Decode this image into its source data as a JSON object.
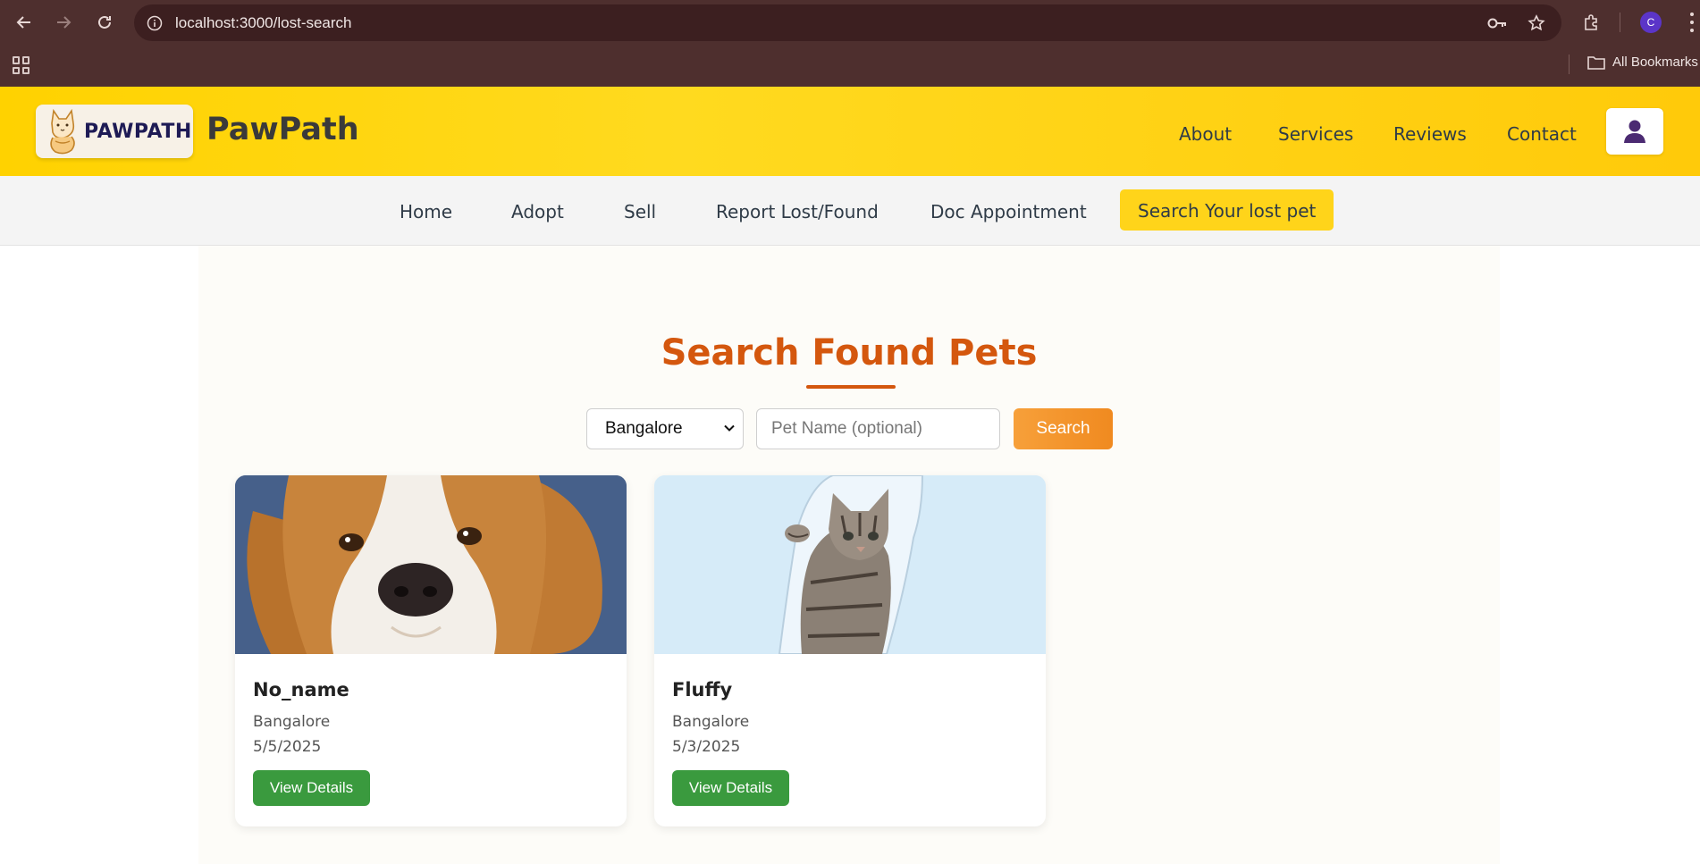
{
  "browser": {
    "url": "localhost:3000/lost-search",
    "avatar_letter": "C",
    "all_bookmarks": "All Bookmarks"
  },
  "header": {
    "logo_text": "PAWPATH",
    "brand": "PawPath",
    "nav": [
      "About",
      "Services",
      "Reviews",
      "Contact"
    ]
  },
  "subnav": {
    "items": [
      "Home",
      "Adopt",
      "Sell",
      "Report Lost/Found",
      "Doc Appointment"
    ],
    "active": "Search Your lost pet"
  },
  "main": {
    "title": "Search Found Pets",
    "city_selected": "Bangalore",
    "name_placeholder": "Pet Name (optional)",
    "search_label": "Search",
    "cards": [
      {
        "name": "No_name",
        "city": "Bangalore",
        "date": "5/5/2025",
        "button": "View Details",
        "image": "dog-photo"
      },
      {
        "name": "Fluffy",
        "city": "Bangalore",
        "date": "5/3/2025",
        "button": "View Details",
        "image": "cat-photo"
      }
    ]
  },
  "colors": {
    "header_yellow": "#ffd200",
    "title_orange": "#d4570e",
    "button_green": "#3a9a3e",
    "search_orange": "#f08a20"
  }
}
